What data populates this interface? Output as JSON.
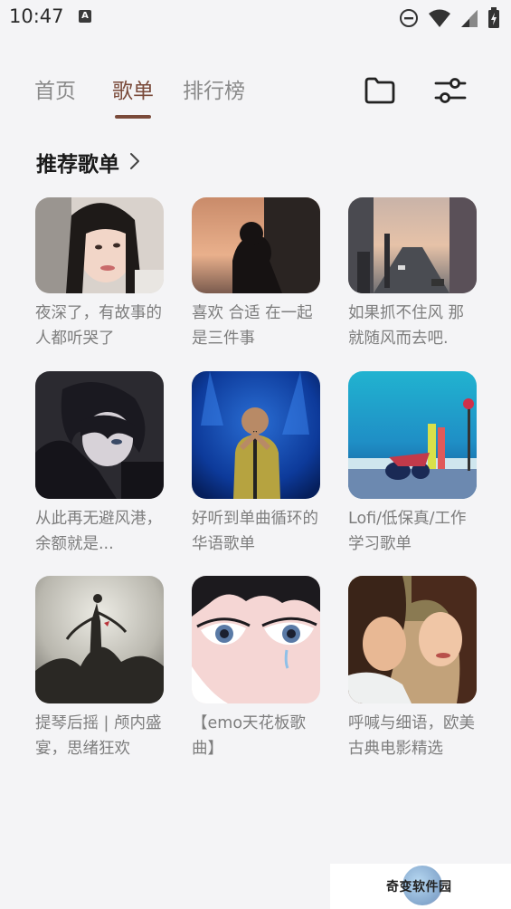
{
  "status_bar": {
    "time": "10:47",
    "indicator": "A",
    "icons": [
      "dnd-icon",
      "wifi-icon",
      "signal-icon",
      "battery-icon"
    ]
  },
  "nav": {
    "tabs": [
      {
        "label": "首页",
        "active": false
      },
      {
        "label": "歌单",
        "active": true
      },
      {
        "label": "排行榜",
        "active": false
      }
    ],
    "icons": [
      "folder-icon",
      "filter-sliders-icon"
    ],
    "active_color": "#7a4a3a",
    "inactive_color": "#8a8a8a"
  },
  "section": {
    "title": "推荐歌单",
    "icon": "chevron-right-icon"
  },
  "playlists": [
    {
      "title": "夜深了，有故事的人都听哭了",
      "cover": "girl-portrait"
    },
    {
      "title": "喜欢 合适 在一起是三件事",
      "cover": "silhouette-sunset"
    },
    {
      "title": "如果抓不住风 那就随风而去吧.",
      "cover": "city-street"
    },
    {
      "title": "从此再无避风港，余额就是...",
      "cover": "anime-boy"
    },
    {
      "title": "好听到单曲循环的华语歌单",
      "cover": "singer-stage"
    },
    {
      "title": "Lofi/低保真/工作学习歌单",
      "cover": "anime-seaside"
    },
    {
      "title": "提琴后摇 | 颅内盛宴，思绪狂欢",
      "cover": "dark-tree"
    },
    {
      "title": "【emo天花板歌曲】",
      "cover": "crying-eyes"
    },
    {
      "title": "呼喊与细语，欧美古典电影精选",
      "cover": "film-couple"
    }
  ],
  "watermark": {
    "text": "奇变软件园"
  }
}
